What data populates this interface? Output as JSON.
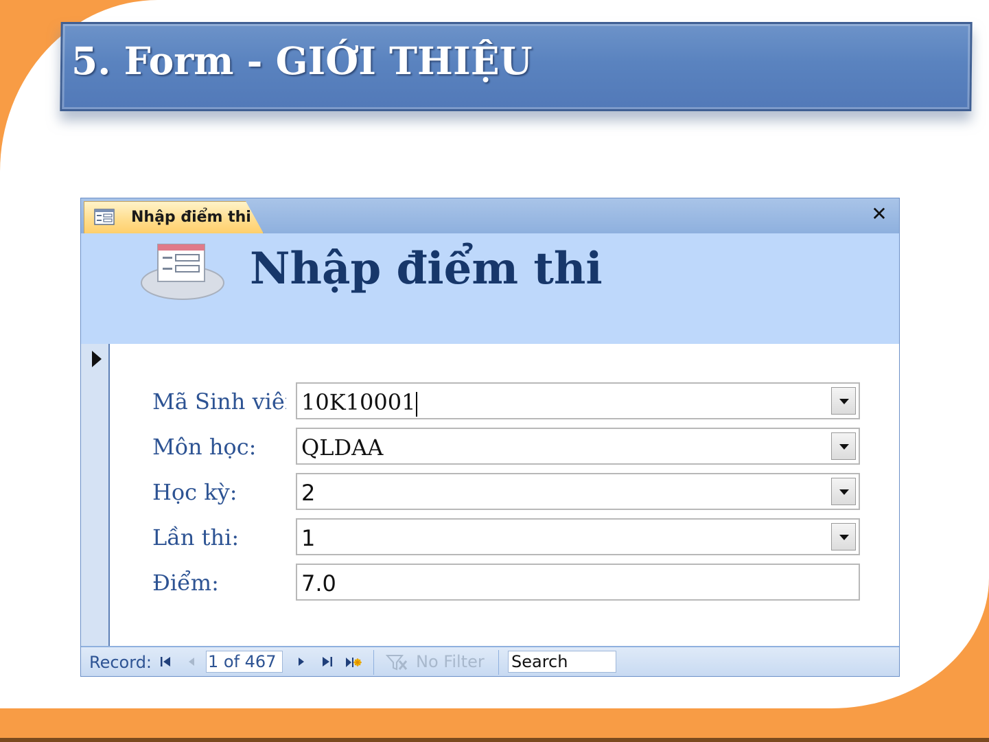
{
  "slide": {
    "title": "5. Form - GIỚI THIỆU"
  },
  "form_window": {
    "tab_label": "Nhập điểm thi",
    "close_icon": "✕",
    "header_title": "Nhập điểm thi",
    "fields": [
      {
        "label": "Mã Sinh viên",
        "value": "10K10001",
        "type": "combobox"
      },
      {
        "label": "Môn học:",
        "value": "QLDAA",
        "type": "combobox"
      },
      {
        "label": "Học kỳ:",
        "value": "2",
        "type": "combobox"
      },
      {
        "label": "Lần thi:",
        "value": "1",
        "type": "combobox"
      },
      {
        "label": "Điểm:",
        "value": "7.0",
        "type": "textbox"
      }
    ]
  },
  "navigation": {
    "record_label": "Record:",
    "position": "1 of 467",
    "filter_label": "No Filter",
    "search_text": "Search",
    "icons": [
      "first-record-icon",
      "previous-record-icon",
      "next-record-icon",
      "last-record-icon",
      "new-record-icon",
      "filter-icon"
    ]
  },
  "colors": {
    "frame_orange": "#f89c45",
    "banner_blue": "#5a83bf",
    "form_header_bg": "#bed8fb",
    "label_blue": "#2d5393",
    "tab_yellow": "#ffdc8a"
  }
}
